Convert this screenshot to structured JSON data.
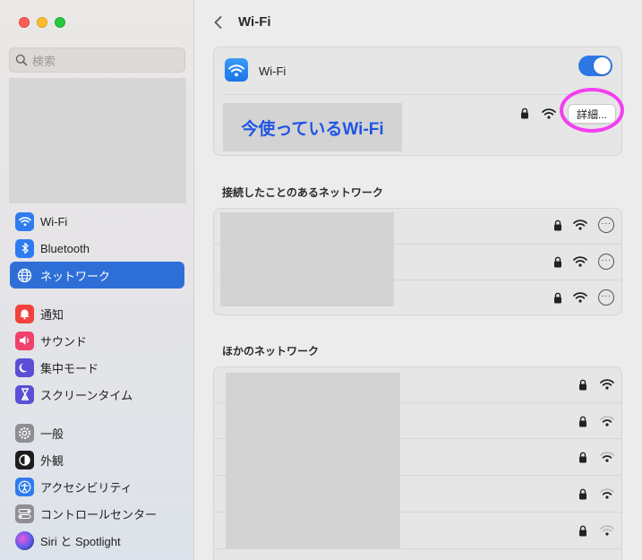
{
  "sidebar": {
    "search_placeholder": "検索",
    "items": [
      {
        "label": "Wi-Fi"
      },
      {
        "label": "Bluetooth"
      },
      {
        "label": "ネットワーク"
      },
      {
        "label": "通知"
      },
      {
        "label": "サウンド"
      },
      {
        "label": "集中モード"
      },
      {
        "label": "スクリーンタイム"
      },
      {
        "label": "一般"
      },
      {
        "label": "外観"
      },
      {
        "label": "アクセシビリティ"
      },
      {
        "label": "コントロールセンター"
      },
      {
        "label": "Siri と Spotlight"
      }
    ]
  },
  "main": {
    "title": "Wi-Fi",
    "wifi_label": "Wi-Fi",
    "wifi_enabled": true,
    "current_network_annotation": "今使っているWi-Fi",
    "detail_button": "詳細...",
    "known_networks_title": "接続したことのあるネットワーク",
    "other_networks_title": "ほかのネットワーク"
  },
  "colors": {
    "accent": "#2e6fd7",
    "toggle_on": "#2e78e6",
    "highlight_ring": "#f33ff0",
    "annotation_text": "#1e55e6"
  }
}
